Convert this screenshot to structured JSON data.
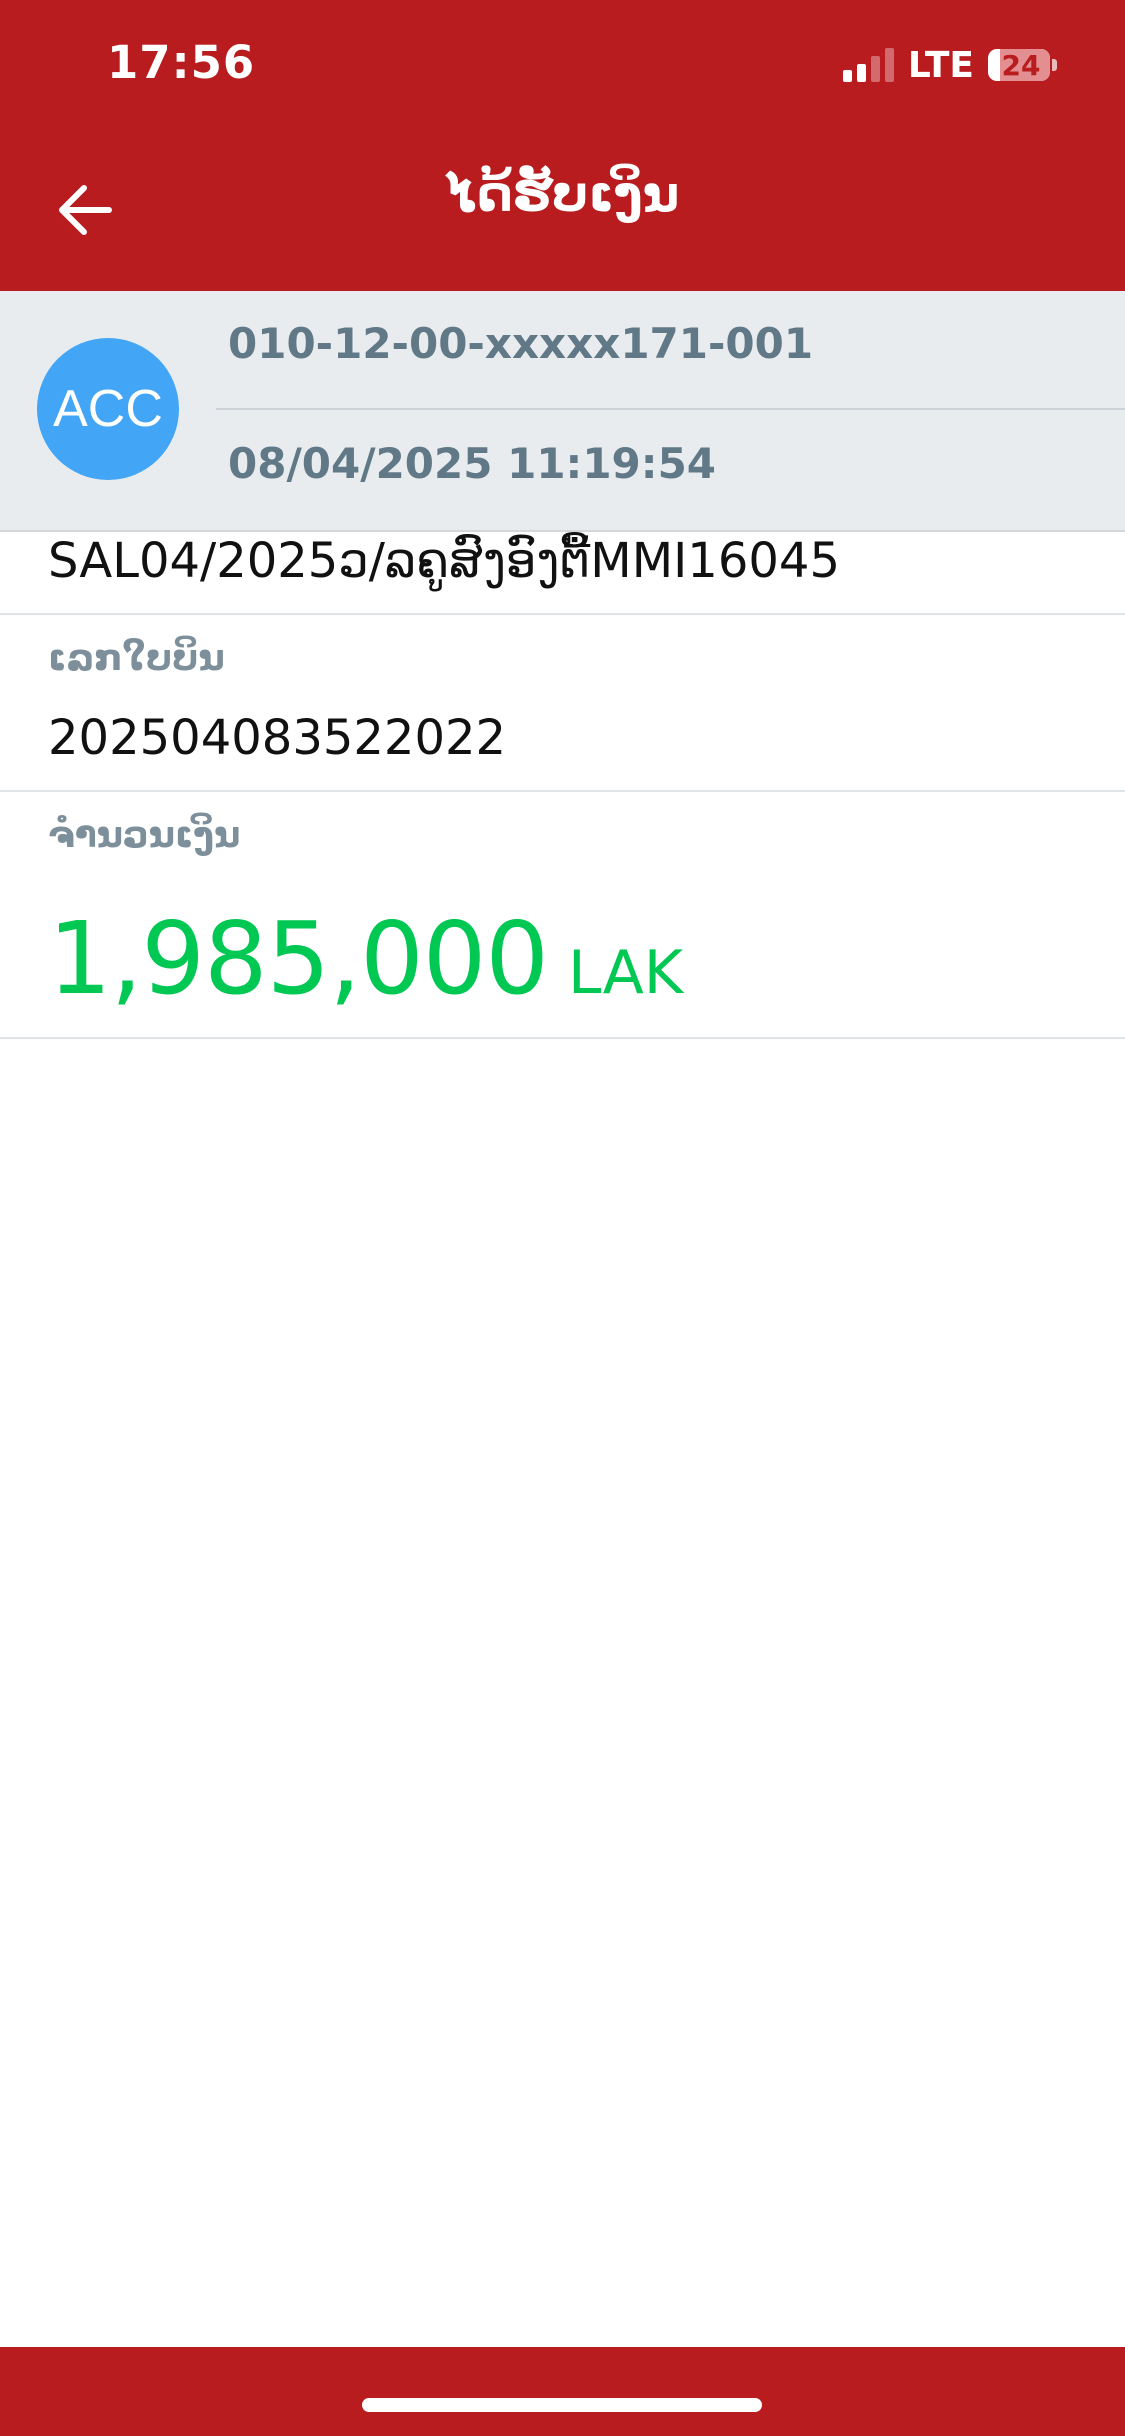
{
  "status_bar": {
    "time": "17:56",
    "network": "LTE",
    "battery": "24",
    "battery_level_percent": 24
  },
  "header": {
    "title": "ໄດ້ຮັບເງິນ",
    "back_icon": "arrow-left-icon"
  },
  "account": {
    "avatar_text": "ACC",
    "number": "010-12-00-xxxxx171-001",
    "datetime": "08/04/2025 11:19:54"
  },
  "transaction": {
    "description": "SAL04/2025ວ/ລຄູສົງອົງຕື້MMI16045",
    "bill_label": "ເລກໃບບິນ",
    "bill_number": "202504083522022",
    "amount_label": "ຈຳນວນເງິນ",
    "amount": "1,985,000",
    "currency": "LAK"
  },
  "colors": {
    "brand_red": "#b81c1f",
    "amount_green": "#00c853",
    "avatar_blue": "#42a5f5",
    "panel_bg": "#e8ecef"
  }
}
